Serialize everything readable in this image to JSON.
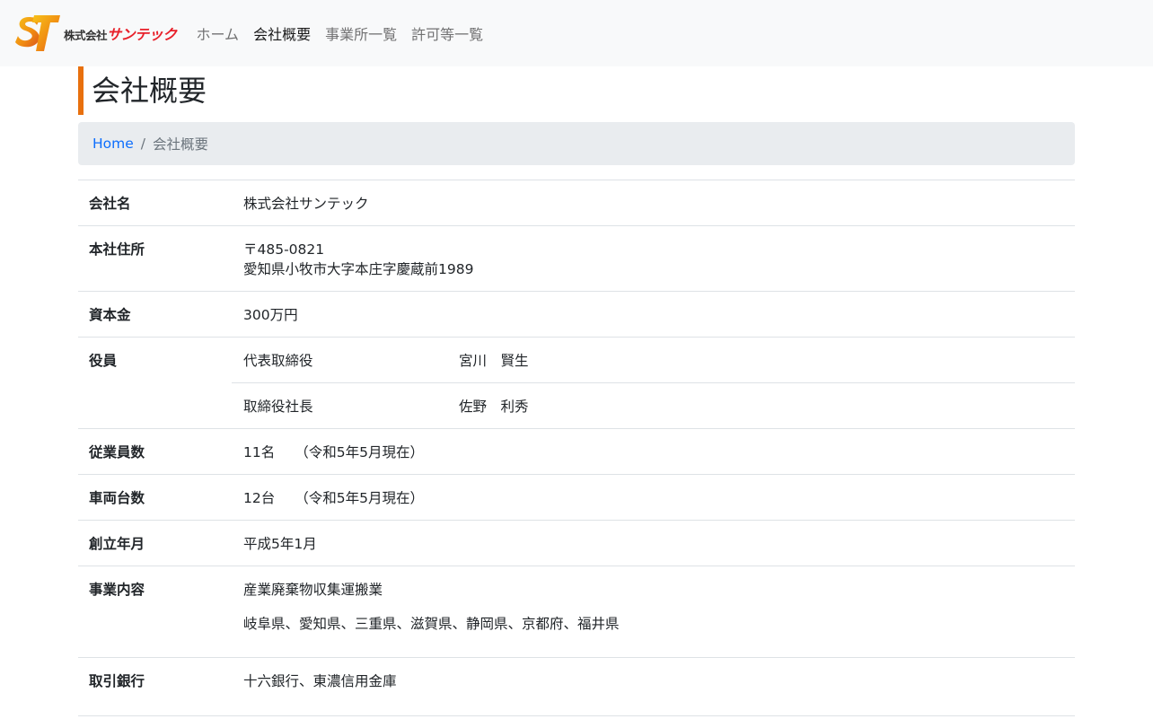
{
  "nav": {
    "brand_small": "株式会社",
    "brand_main": "サンテック",
    "items": [
      {
        "label": "ホーム"
      },
      {
        "label": "会社概要"
      },
      {
        "label": "事業所一覧"
      },
      {
        "label": "許可等一覧"
      }
    ],
    "active_index": 1
  },
  "page": {
    "title": "会社概要",
    "breadcrumb": {
      "home": "Home",
      "current": "会社概要"
    }
  },
  "company": {
    "name_label": "会社名",
    "name": "株式会社サンテック",
    "address_label": "本社住所",
    "postal": "〒485-0821",
    "address": "愛知県小牧市大字本庄字慶蔵前1989",
    "capital_label": "資本金",
    "capital": "300万円",
    "officers_label": "役員",
    "officers": [
      {
        "role": "代表取締役",
        "name": "宮川　賢生"
      },
      {
        "role": "取締役社長",
        "name": "佐野　利秀"
      }
    ],
    "employees_label": "従業員数",
    "employees": "11名",
    "employees_note": "（令和5年5月現在）",
    "vehicles_label": "車両台数",
    "vehicles": "12台",
    "vehicles_note": "（令和5年5月現在）",
    "founded_label": "創立年月",
    "founded": "平成5年1月",
    "business_label": "事業内容",
    "business": "産業廃棄物収集運搬業",
    "business_area": "岐阜県、愛知県、三重県、滋賀県、静岡県、京都府、福井県",
    "bank_label": "取引銀行",
    "bank": "十六銀行、東濃信用金庫"
  },
  "colors": {
    "accent_border": "#e8700e",
    "link": "#0d6efd",
    "navbar_bg": "#f8f9fa",
    "breadcrumb_bg": "#e9ecef"
  }
}
